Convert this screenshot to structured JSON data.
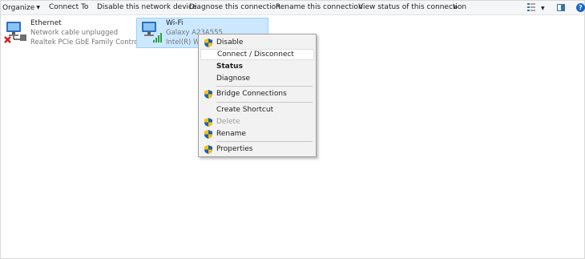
{
  "toolbar": {
    "organize": "Organize",
    "connect_to": "Connect To",
    "disable_device": "Disable this network device",
    "diagnose": "Diagnose this connection",
    "rename": "Rename this connection",
    "view_status": "View status of this connection",
    "more": "»",
    "help": "?"
  },
  "connections": {
    "ethernet": {
      "name": "Ethernet",
      "status": "Network cable unplugged",
      "adapter": "Realtek PCIe GbE Family Controller",
      "icon": "network-disconnected-icon"
    },
    "wifi": {
      "name": "Wi-Fi",
      "status": "Galaxy A23A555",
      "adapter": "Intel(R) Wir",
      "icon": "wifi-adapter-icon",
      "selected": true
    }
  },
  "context_menu": {
    "items": [
      {
        "label": "Disable",
        "shield": true
      },
      {
        "label": "Connect / Disconnect",
        "shield": false,
        "hovered": true
      },
      {
        "label": "Status",
        "shield": false,
        "default": true
      },
      {
        "label": "Diagnose",
        "shield": false
      },
      {
        "label": "Bridge Connections",
        "shield": true
      },
      {
        "label": "Create Shortcut",
        "shield": false
      },
      {
        "label": "Delete",
        "shield": true,
        "disabled": true
      },
      {
        "label": "Rename",
        "shield": true
      },
      {
        "label": "Properties",
        "shield": true
      }
    ]
  },
  "colors": {
    "selection_bg": "#cce8ff",
    "selection_border": "#99d1ff",
    "menu_bg": "#f2f2f2",
    "disabled_text": "#9d9d9d",
    "help_blue": "#1a66c8"
  }
}
